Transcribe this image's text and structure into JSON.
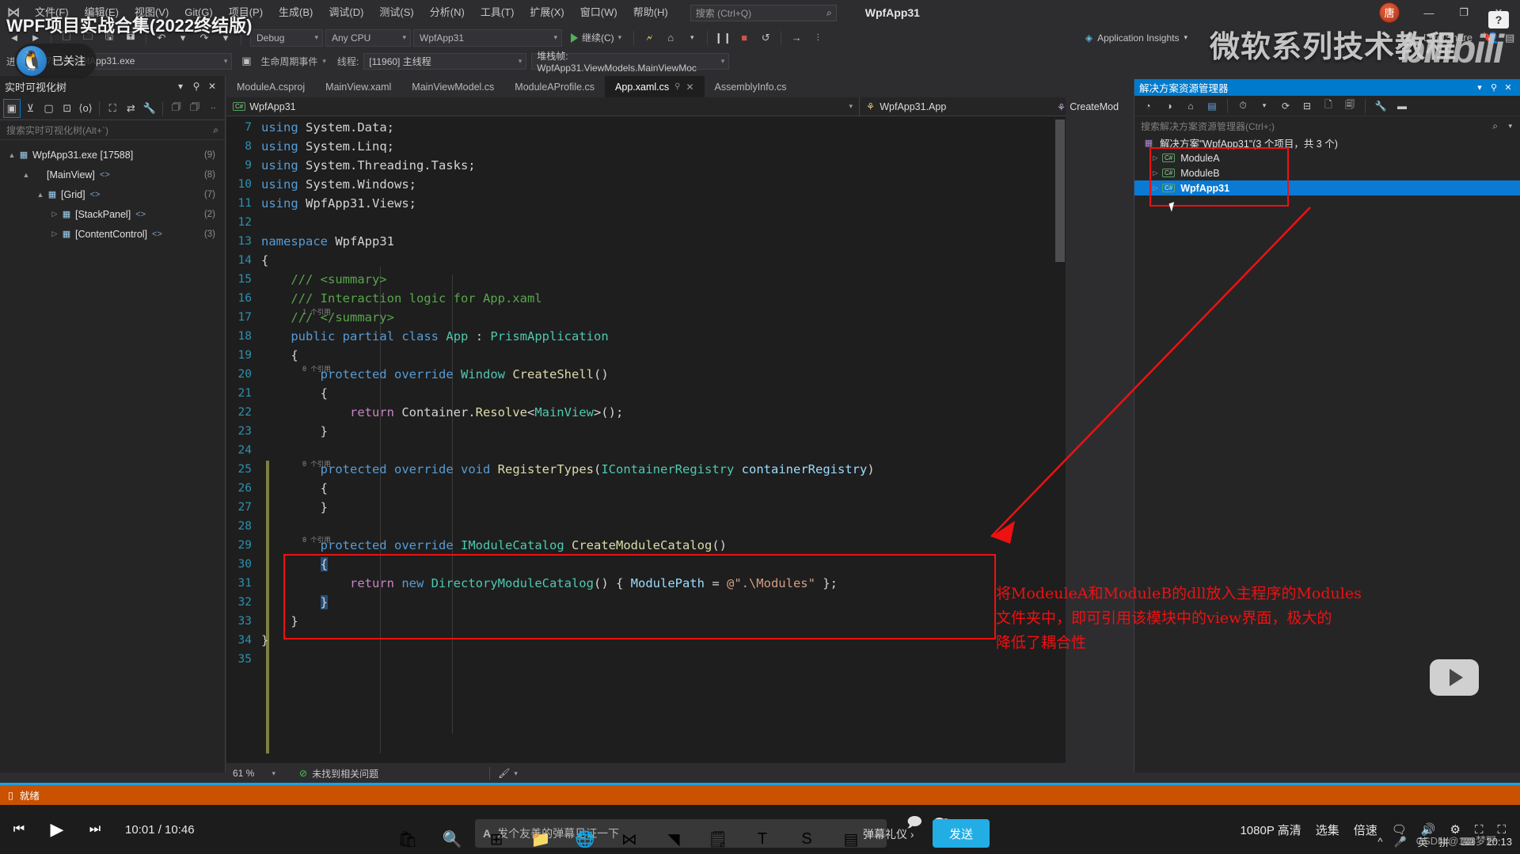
{
  "window": {
    "app_title": "WpfApp31",
    "overlay_title": "WPF项目实战合集(2022终结版)",
    "watermark_right": "微软系列技术教程",
    "watermark_bili": "bilibili",
    "badge_zhou": "唐",
    "live_share": "Live Share",
    "app_insights": "Application Insights",
    "minimize": "—",
    "maximize": "❐",
    "close": "✕"
  },
  "menu": {
    "items": [
      "文件(F)",
      "编辑(E)",
      "视图(V)",
      "Git(G)",
      "项目(P)",
      "生成(B)",
      "调试(D)",
      "测试(S)",
      "分析(N)",
      "工具(T)",
      "扩展(X)",
      "窗口(W)",
      "帮助(H)"
    ],
    "search_placeholder": "搜索 (Ctrl+Q)",
    "search_icon": "search-icon"
  },
  "toolbar": {
    "config": "Debug",
    "platform": "Any CPU",
    "startup_project": "WpfApp31",
    "run_label": "继续(C)",
    "pause": "❙❙",
    "stop": "■",
    "restart": "↺",
    "step": "→"
  },
  "debugbar": {
    "process_label": "进程:",
    "process": "[17588] WpfApp31.exe",
    "lifecycle": "生命周期事件",
    "thread_label": "线程:",
    "thread": "[11960] 主线程",
    "stackframe": "堆栈帧: WpfApp31.ViewModels.MainViewMoc"
  },
  "live_visual_tree": {
    "title": "实时可视化树",
    "search_placeholder": "搜索实时可视化树(Alt+`)",
    "toolbar_icons": [
      "select-element-icon",
      "pointer-icon",
      "highlight-icon",
      "preview-icon",
      "settings-icon",
      "layout-icon",
      "swap-icon",
      "wrench-icon",
      "duplicate-icon",
      "copy-icon",
      "overflow-icon"
    ],
    "nodes": [
      {
        "label": "WpfApp31.exe [17588]",
        "count": "(9)",
        "depth": 0,
        "twisty": "▲",
        "icon": "process-icon"
      },
      {
        "label": "[MainView]",
        "count": "(8)",
        "depth": 1,
        "twisty": "▲",
        "icon": "",
        "angle": "<>"
      },
      {
        "label": "[Grid]",
        "count": "(7)",
        "depth": 2,
        "twisty": "▲",
        "icon": "grid-icon",
        "angle": "<>"
      },
      {
        "label": "[StackPanel]",
        "count": "(2)",
        "depth": 3,
        "twisty": "▷",
        "icon": "stackpanel-icon",
        "angle": "<>"
      },
      {
        "label": "[ContentControl]",
        "count": "(3)",
        "depth": 3,
        "twisty": "▷",
        "icon": "contentcontrol-icon",
        "angle": "<>"
      }
    ]
  },
  "editor": {
    "tabs": [
      {
        "label": "ModuleA.csproj",
        "active": false
      },
      {
        "label": "MainView.xaml",
        "active": false
      },
      {
        "label": "MainViewModel.cs",
        "active": false
      },
      {
        "label": "ModuleAProfile.cs",
        "active": false
      },
      {
        "label": "App.xaml.cs",
        "active": true
      },
      {
        "label": "AssemblyInfo.cs",
        "active": false
      }
    ],
    "nav_left": "WpfApp31",
    "nav_right": "WpfApp31.App",
    "nav_right_far": "CreateMod",
    "lines": [
      {
        "n": "7",
        "html": "<span class=\"k\">using</span> System.Data;"
      },
      {
        "n": "8",
        "html": "<span class=\"k\">using</span> System.Linq;"
      },
      {
        "n": "9",
        "html": "<span class=\"k\">using</span> System.Threading.Tasks;"
      },
      {
        "n": "10",
        "html": "<span class=\"k\">using</span> System.Windows;"
      },
      {
        "n": "11",
        "html": "<span class=\"k\">using</span> WpfApp31.Views;"
      },
      {
        "n": "12",
        "html": ""
      },
      {
        "n": "13",
        "html": "<span class=\"k\">namespace</span> WpfApp31"
      },
      {
        "n": "14",
        "html": "{"
      },
      {
        "n": "15",
        "html": "    <span class=\"cm\">/// &lt;summary&gt;</span>"
      },
      {
        "n": "16",
        "html": "    <span class=\"cm\">/// Interaction logic for App.xaml</span>"
      },
      {
        "n": "17",
        "html": "    <span class=\"cm\">/// &lt;/summary&gt;</span>",
        "hint": "1 个引用"
      },
      {
        "n": "18",
        "html": "    <span class=\"k\">public</span> <span class=\"k\">partial</span> <span class=\"k\">class</span> <span class=\"kc\">App</span> : <span class=\"kc\">PrismApplication</span>"
      },
      {
        "n": "19",
        "html": "    {"
      },
      {
        "n": "20",
        "html": "        <span class=\"k\">protected</span> <span class=\"k\">override</span> <span class=\"kc\">Window</span> <span class=\"fn\">CreateShell</span>()",
        "hint": "0 个引用"
      },
      {
        "n": "21",
        "html": "        {"
      },
      {
        "n": "22",
        "html": "            <span class=\"pu\">return</span> Container.<span class=\"fn\">Resolve</span>&lt;<span class=\"kc\">MainView</span>&gt;();"
      },
      {
        "n": "23",
        "html": "        }"
      },
      {
        "n": "24",
        "html": ""
      },
      {
        "n": "25",
        "html": "        <span class=\"k\">protected</span> <span class=\"k\">override</span> <span class=\"k\">void</span> <span class=\"fn\">RegisterTypes</span>(<span class=\"kc\">IContainerRegistry</span> <span class=\"pv\">containerRegistry</span>)",
        "hint": "0 个引用"
      },
      {
        "n": "26",
        "html": "        {"
      },
      {
        "n": "27",
        "html": "        }"
      },
      {
        "n": "28",
        "html": ""
      },
      {
        "n": "29",
        "html": "        <span class=\"k\">protected</span> <span class=\"k\">override</span> <span class=\"kc\">IModuleCatalog</span> <span class=\"fn\">CreateModuleCatalog</span>()",
        "hint": "0 个引用"
      },
      {
        "n": "30",
        "html": "        <span class=\"sel\">{</span>"
      },
      {
        "n": "31",
        "html": "            <span class=\"pu\">return</span> <span class=\"k\">new</span> <span class=\"kc\">DirectoryModuleCatalog</span>() { <span class=\"pv\">ModulePath</span> = <span class=\"st\">@\".\\Modules\"</span> };"
      },
      {
        "n": "32",
        "html": "        <span class=\"sel\">}</span>"
      },
      {
        "n": "33",
        "html": "    }"
      },
      {
        "n": "34",
        "html": "}"
      },
      {
        "n": "35",
        "html": ""
      }
    ]
  },
  "solution_explorer": {
    "title": "解决方案资源管理器",
    "search_placeholder": "搜索解决方案资源管理器(Ctrl+;)",
    "toolbar_icons": [
      "back-icon",
      "forward-icon",
      "home-icon",
      "switch-view-icon",
      "pending-changes-icon",
      "refresh-icon",
      "collapse-all-icon",
      "show-all-files-icon",
      "properties-icon",
      "wrench-icon",
      "minus-icon"
    ],
    "root": "解决方案\"WpfApp31\"(3 个项目，共 3 个)",
    "nodes": [
      {
        "label": "ModuleA",
        "selected": false,
        "twisty": "▷",
        "icon": "csharp-project-icon"
      },
      {
        "label": "ModuleB",
        "selected": false,
        "twisty": "▷",
        "icon": "csharp-project-icon"
      },
      {
        "label": "WpfApp31",
        "selected": true,
        "twisty": "▷",
        "icon": "csharp-project-icon"
      }
    ]
  },
  "annotation": {
    "text_lines": [
      "将ModeuleA和ModuleB的dll放入主程序的Modules",
      "文件夹中，即可引用该模块中的view界面，极大的",
      "降低了耦合性"
    ],
    "color": "#ee1111"
  },
  "zoombar": {
    "zoom": "61 %",
    "issues": "未找到相关问题",
    "issue_icon": "check-circle-icon"
  },
  "statusbar": {
    "text": "就绪",
    "icon": "stop-square-icon",
    "color": "#ca5100"
  },
  "player": {
    "prev": "prev-icon",
    "play": "play-icon",
    "next": "next-icon",
    "time": "10:01 / 10:46",
    "danmu_placeholder": "发个友善的弹幕见证一下",
    "danmu_gift": "弹幕礼仪 ›",
    "send": "发送",
    "quality": "1080P 高清",
    "episodes": "选集",
    "speed": "倍速",
    "icons": [
      "subtitle-icon",
      "volume-icon",
      "settings-icon",
      "widescreen-icon",
      "fullscreen-icon"
    ]
  },
  "tray": {
    "ime_en": "英",
    "ime_pin": "拼",
    "clock": "20:13",
    "watermark": "CSDN @123梦野"
  }
}
